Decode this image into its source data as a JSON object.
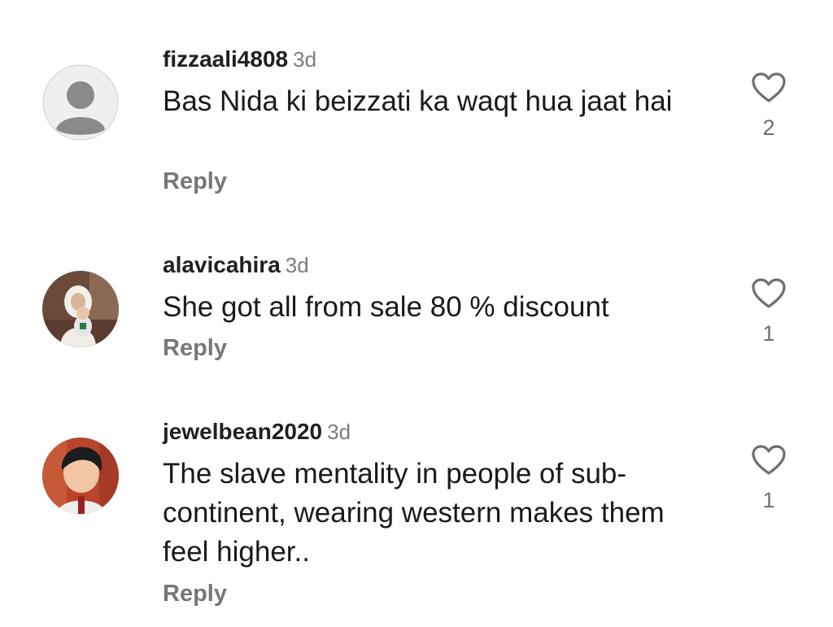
{
  "comments": [
    {
      "username": "fizzaali4808",
      "time": "3d",
      "text": "Bas Nida ki beizzati ka waqt hua jaat hai",
      "reply_label": "Reply",
      "likes": "2",
      "avatar": "default-person-icon"
    },
    {
      "username": "alavicahira",
      "time": "3d",
      "text": "She got all from sale 80 % discount",
      "reply_label": "Reply",
      "likes": "1",
      "avatar": "photo-woman-with-baby"
    },
    {
      "username": "jewelbean2020",
      "time": "3d",
      "text": "The slave mentality in people of sub-continent, wearing western makes them feel higher..",
      "reply_label": "Reply",
      "likes": "1",
      "avatar": "photo-young-boy"
    }
  ],
  "colors": {
    "text": "#1a1a1a",
    "muted": "#7d7d7d",
    "reply": "#777777",
    "heart": "#6f6f6f"
  }
}
